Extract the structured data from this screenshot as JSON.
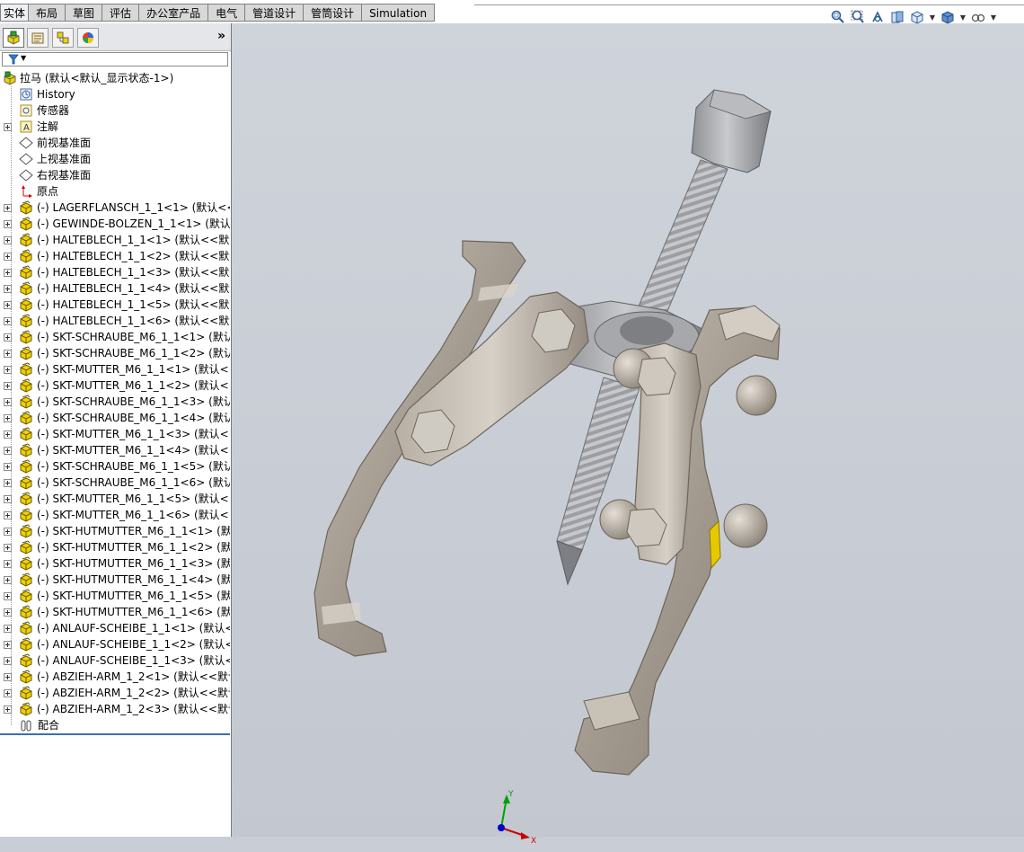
{
  "tabs": [
    "实体",
    "布局",
    "草图",
    "评估",
    "办公室产品",
    "电气",
    "管道设计",
    "管筒设计",
    "Simulation"
  ],
  "view_toolbar": {
    "icons": [
      "zoom-to-fit-icon",
      "zoom-to-area-icon",
      "previous-view-icon",
      "section-view-icon",
      "view-orientation-icon",
      "display-style-icon",
      "hide-show-items-icon"
    ]
  },
  "panel": {
    "tabs": [
      "feature-manager-icon",
      "property-manager-icon",
      "configuration-manager-icon",
      "display-manager-icon"
    ],
    "expand_label": "»"
  },
  "tree": {
    "root": "拉马  (默认<默认_显示状态-1>)",
    "folders": [
      {
        "label": "History",
        "icon": "history-icon"
      },
      {
        "label": "传感器",
        "icon": "sensor-icon"
      },
      {
        "label": "注解",
        "icon": "annotation-icon"
      },
      {
        "label": "前视基准面",
        "icon": "plane-icon"
      },
      {
        "label": "上视基准面",
        "icon": "plane-icon"
      },
      {
        "label": "右视基准面",
        "icon": "plane-icon"
      },
      {
        "label": "原点",
        "icon": "origin-icon"
      }
    ],
    "components": [
      "(-) LAGERFLANSCH_1_1<1> (默认<<默认",
      "(-) GEWINDE-BOLZEN_1_1<1> (默认<",
      "(-) HALTEBLECH_1_1<1> (默认<<默认",
      "(-) HALTEBLECH_1_1<2> (默认<<默认",
      "(-) HALTEBLECH_1_1<3> (默认<<默认",
      "(-) HALTEBLECH_1_1<4> (默认<<默认",
      "(-) HALTEBLECH_1_1<5> (默认<<默认",
      "(-) HALTEBLECH_1_1<6> (默认<<默认",
      "(-) SKT-SCHRAUBE_M6_1_1<1> (默认",
      "(-) SKT-SCHRAUBE_M6_1_1<2> (默认",
      "(-) SKT-MUTTER_M6_1_1<1> (默认<<",
      "(-) SKT-MUTTER_M6_1_1<2> (默认<<",
      "(-) SKT-SCHRAUBE_M6_1_1<3> (默认",
      "(-) SKT-SCHRAUBE_M6_1_1<4> (默认",
      "(-) SKT-MUTTER_M6_1_1<3> (默认<<",
      "(-) SKT-MUTTER_M6_1_1<4> (默认<<",
      "(-) SKT-SCHRAUBE_M6_1_1<5> (默认",
      "(-) SKT-SCHRAUBE_M6_1_1<6> (默认",
      "(-) SKT-MUTTER_M6_1_1<5> (默认<<",
      "(-) SKT-MUTTER_M6_1_1<6> (默认<<",
      "(-) SKT-HUTMUTTER_M6_1_1<1> (默认",
      "(-) SKT-HUTMUTTER_M6_1_1<2> (默认",
      "(-) SKT-HUTMUTTER_M6_1_1<3> (默认",
      "(-) SKT-HUTMUTTER_M6_1_1<4> (默认",
      "(-) SKT-HUTMUTTER_M6_1_1<5> (默认",
      "(-) SKT-HUTMUTTER_M6_1_1<6> (默认",
      "(-) ANLAUF-SCHEIBE_1_1<1> (默认<<",
      "(-) ANLAUF-SCHEIBE_1_1<2> (默认<<",
      "(-) ANLAUF-SCHEIBE_1_1<3> (默认<<",
      "(-) ABZIEH-ARM_1_2<1> (默认<<默认",
      "(-) ABZIEH-ARM_1_2<2> (默认<<默认",
      "(-) ABZIEH-ARM_1_2<3> (默认<<默认"
    ],
    "mates": "配合"
  },
  "triad": {
    "x": "X",
    "y": "Y"
  },
  "colors": {
    "part_metal": "#a39a8f",
    "accent_yellow": "#e6c800",
    "axis_x": "#cc0000",
    "axis_y": "#00a000",
    "axis_z": "#0000cc"
  }
}
